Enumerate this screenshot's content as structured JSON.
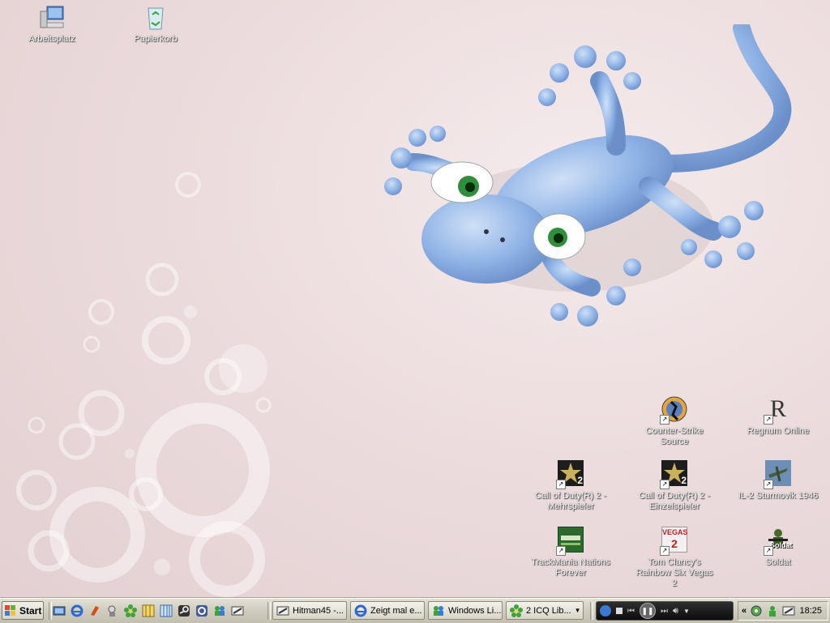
{
  "desktop": {
    "icons": [
      {
        "id": "arbeitsplatz",
        "label": "Arbeitsplatz",
        "icon": "computer-icon"
      },
      {
        "id": "papierkorb",
        "label": "Papierkorb",
        "icon": "recycle-bin-icon"
      },
      {
        "id": "css",
        "label": "Counter-Strike Source",
        "icon": "counter-strike-icon"
      },
      {
        "id": "regnum",
        "label": "Regnum Online",
        "icon": "regnum-icon"
      },
      {
        "id": "cod-mp",
        "label": "Call of Duty(R) 2 - Mehrspieler",
        "icon": "call-of-duty-icon"
      },
      {
        "id": "cod-sp",
        "label": "Call of Duty(R) 2 - Einzelspieler",
        "icon": "call-of-duty-icon"
      },
      {
        "id": "il2",
        "label": "IL-2 Sturmovik 1946",
        "icon": "il2-icon"
      },
      {
        "id": "trackmania",
        "label": "TrackMania Nations Forever",
        "icon": "trackmania-icon"
      },
      {
        "id": "vegas",
        "label": "Tom Clancy's Rainbow Six Vegas 2",
        "icon": "vegas-icon"
      },
      {
        "id": "soldat",
        "label": "Soldat",
        "icon": "soldat-icon"
      }
    ],
    "icon_texts": {
      "cod_badge": "2",
      "vegas_text": "VEGAS",
      "vegas_badge": "2",
      "soldat_text": "Soldat",
      "regnum_letter": "R"
    }
  },
  "taskbar": {
    "start_label": "Start",
    "tasks": [
      {
        "label": "Hitman45 -...",
        "icon": "window-icon"
      },
      {
        "label": "Zeigt mal e...",
        "icon": "internet-explorer-icon"
      },
      {
        "label": "Windows Li...",
        "icon": "messenger-icon"
      },
      {
        "label": "2 ICQ Lib...",
        "icon": "icq-icon"
      }
    ],
    "tray_chevron": "«",
    "clock": "18:25"
  },
  "colors": {
    "gecko": "#8fb3e6",
    "taskbar": "#d6d2c4",
    "label_text": "#ffffff"
  }
}
